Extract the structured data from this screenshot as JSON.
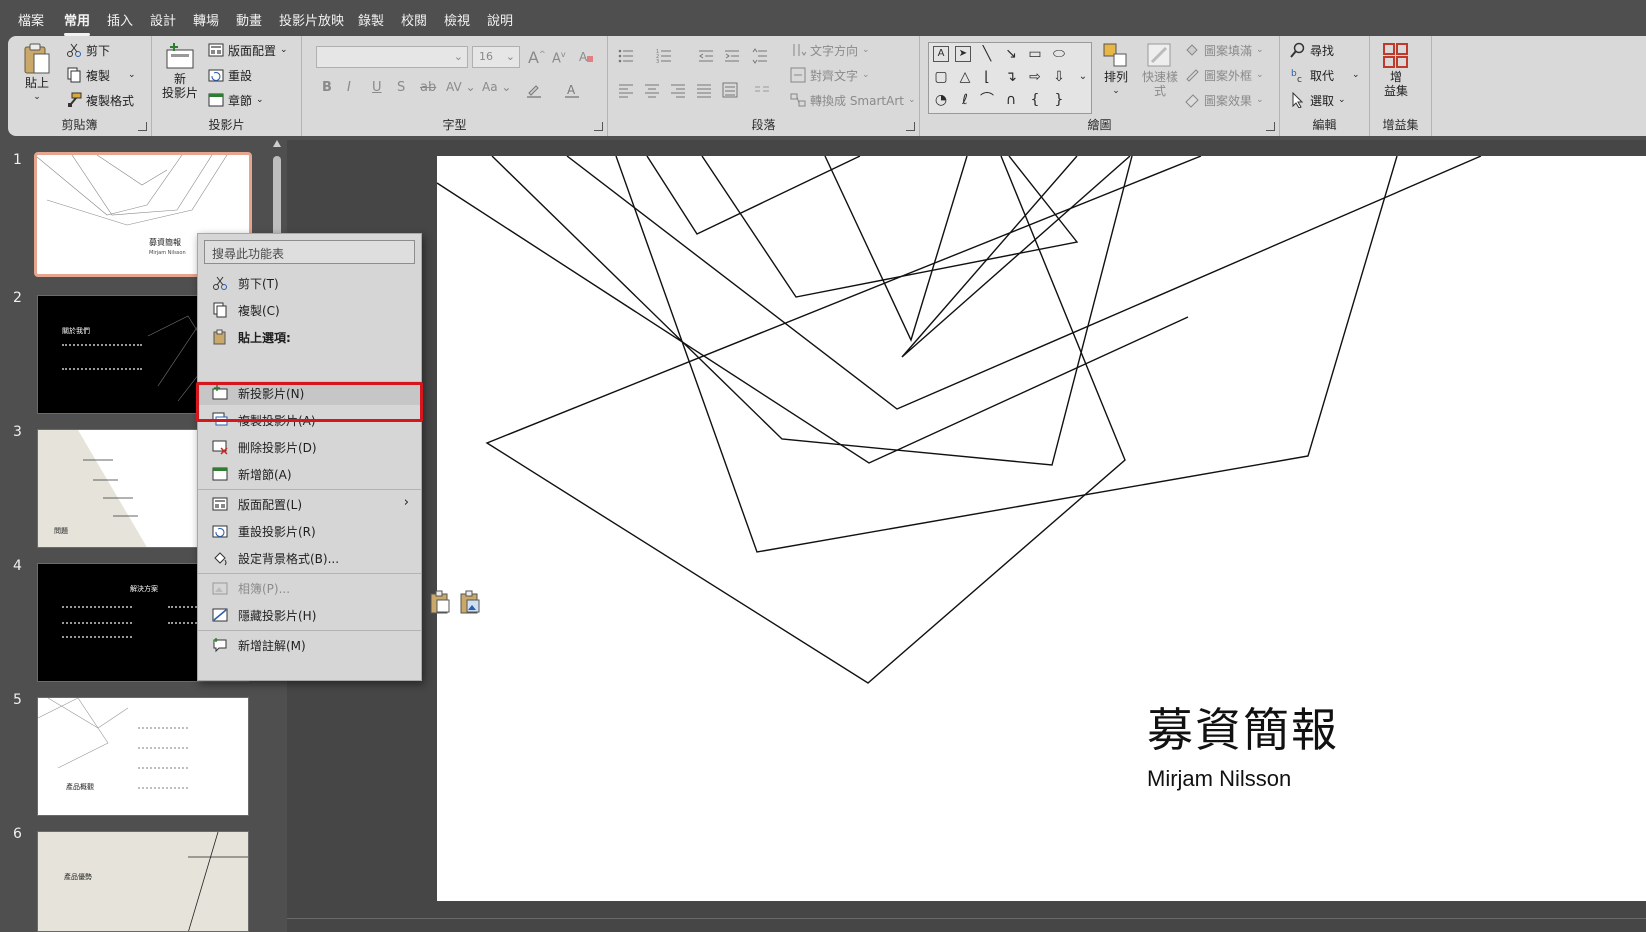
{
  "menu_tabs": [
    "檔案",
    "常用",
    "插入",
    "設計",
    "轉場",
    "動畫",
    "投影片放映",
    "錄製",
    "校閱",
    "檢視",
    "說明"
  ],
  "active_tab": "常用",
  "ribbon": {
    "clipboard": {
      "label": "剪貼簿",
      "paste": "貼上",
      "cut": "剪下",
      "copy": "複製",
      "format_painter": "複製格式"
    },
    "slides": {
      "label": "投影片",
      "new_slide": "新\n投影片",
      "new_slide_line1": "新",
      "new_slide_line2": "投影片",
      "layout": "版面配置",
      "reset": "重設",
      "section": "章節"
    },
    "font": {
      "label": "字型",
      "font_size": "16",
      "bold": "B",
      "italic": "I",
      "underline": "U",
      "shadow": "S",
      "strikethrough": "ab",
      "spacing": "AV",
      "case": "Aa",
      "grow": "A",
      "shrink": "A"
    },
    "paragraph": {
      "label": "段落",
      "text_direction": "文字方向",
      "align_text": "對齊文字",
      "smartart": "轉換成 SmartArt"
    },
    "drawing": {
      "label": "繪圖",
      "arrange": "排列",
      "quick_styles_line1": "快速樣",
      "quick_styles_line2": "式",
      "shape_fill": "圖案填滿",
      "shape_outline": "圖案外框",
      "shape_effects": "圖案效果"
    },
    "editing": {
      "label": "編輯",
      "find": "尋找",
      "replace": "取代",
      "select": "選取"
    },
    "addins": {
      "label": "增益集",
      "addins_line1": "增",
      "addins_line2": "益集"
    }
  },
  "slide_numbers": [
    "1",
    "2",
    "3",
    "4",
    "5",
    "6"
  ],
  "thumbnails": {
    "t1_title": "募資簡報",
    "t1_sub": "Mirjam Nilsson",
    "t2_title": "關於我們",
    "t3_title": "問題",
    "t4_title": "解決方案",
    "t5_title": "產品概觀",
    "t6_title": "產品優勢"
  },
  "context_menu": {
    "search_placeholder": "搜尋此功能表",
    "items": [
      {
        "label": "剪下(T)",
        "icon": "scissors-icon",
        "enabled": true
      },
      {
        "label": "複製(C)",
        "icon": "copy-icon",
        "enabled": true
      },
      {
        "label": "貼上選項:",
        "icon": "paste-icon",
        "enabled": true
      },
      {
        "label": "新投影片(N)",
        "icon": "new-slide-icon",
        "enabled": true,
        "highlighted": true
      },
      {
        "label": "複製投影片(A)",
        "icon": "duplicate-slide-icon",
        "enabled": true
      },
      {
        "label": "刪除投影片(D)",
        "icon": "delete-slide-icon",
        "enabled": true
      },
      {
        "label": "新增節(A)",
        "icon": "add-section-icon",
        "enabled": true
      },
      {
        "label": "版面配置(L)",
        "icon": "layout-icon",
        "enabled": true,
        "submenu": true
      },
      {
        "label": "重設投影片(R)",
        "icon": "reset-slide-icon",
        "enabled": true
      },
      {
        "label": "設定背景格式(B)...",
        "icon": "format-background-icon",
        "enabled": true
      },
      {
        "label": "相簿(P)...",
        "icon": "photo-album-icon",
        "enabled": false
      },
      {
        "label": "隱藏投影片(H)",
        "icon": "hide-slide-icon",
        "enabled": true
      },
      {
        "label": "新增註解(M)",
        "icon": "new-comment-icon",
        "enabled": true
      }
    ]
  },
  "main_slide": {
    "title": "募資簡報",
    "subtitle": "Mirjam Nilsson"
  },
  "colors": {
    "highlight": "#d6161f",
    "selected_thumb_border": "#e5a58f",
    "app_background": "#4f4f4f",
    "ribbon": "#d9d9d9"
  }
}
